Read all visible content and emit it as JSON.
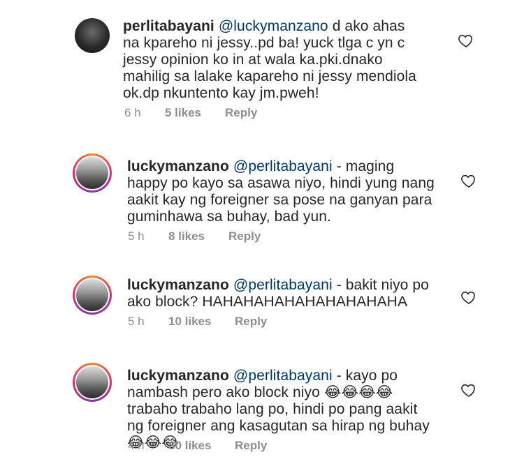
{
  "comments": [
    {
      "username": "perlitabayani",
      "mention": "@luckymanzano",
      "text": "d ako ahas na kpareho ni jessy..pd ba! yuck tlga c yn c jessy opinion ko in at wala ka.pki.dnako mahilig sa lalake kapareho ni jessy mendiola ok.dp nkuntento kay jm.pweh!",
      "time": "6 h",
      "likes": "5 likes",
      "reply": "Reply"
    },
    {
      "username": "luckymanzano",
      "mention": "@perlitabayani",
      "text": "- maging happy po kayo sa asawa niyo, hindi yung nang aakit kay ng foreigner sa pose na ganyan para guminhawa sa buhay, bad yun.",
      "time": "5 h",
      "likes": "8 likes",
      "reply": "Reply"
    },
    {
      "username": "luckymanzano",
      "mention": "@perlitabayani",
      "text": "- bakit niyo po ako block? HAHAHAHAHAHAHAHAHAHA",
      "time": "5 h",
      "likes": "10 likes",
      "reply": "Reply"
    },
    {
      "username": "luckymanzano",
      "mention": "@perlitabayani",
      "text_a": "- kayo po nambash pero ako block niyo",
      "emoji_a": "😂😂😂😂",
      "text_b": "trabaho trabaho lang po, hindi po pang aakit ng foreigner ang kasagutan sa hirap ng buhay",
      "emoji_b": "😂😂😂",
      "time": "4 h",
      "likes": "30 likes",
      "reply": "Reply"
    }
  ],
  "icons": {
    "like": "heart-outline-icon",
    "emoji": "face-with-tears-of-joy-icon"
  },
  "colors": {
    "text": "#262626",
    "mention": "#00376b",
    "meta": "#8e8e8e",
    "story_ring": "#dd2a7b"
  }
}
